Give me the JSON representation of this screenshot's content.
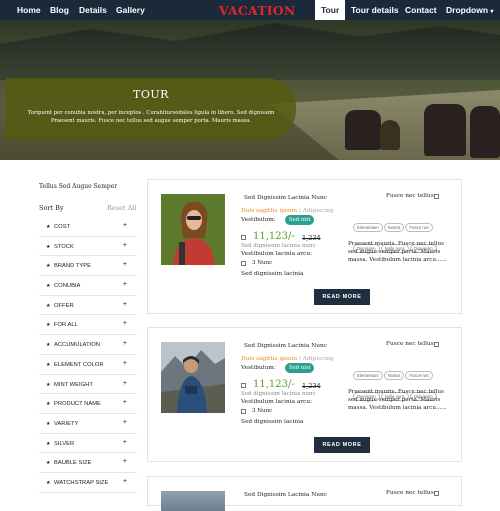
{
  "nav": {
    "items": [
      "Home",
      "Blog",
      "Details",
      "Gallery"
    ],
    "brand": "VACATION",
    "right": [
      "Tour",
      "Tour details",
      "Contact",
      "Dropdown"
    ]
  },
  "hero": {
    "title": "TOUR",
    "desc": "Torquent per conubia nostra, per inceptos . Curabitursodales ligula in libero. Sed dignissim Praesent mauris. Fusce nec tellus sed augue semper porta. Mauris massa."
  },
  "sidebar": {
    "title": "Tellus Sed Augue Semper",
    "sort_label": "Sort By",
    "reset_label": "Reset All",
    "filters": [
      "COST",
      "STOCK",
      "BRAND TYPE",
      "CONUBIA",
      "OFFER",
      "FOR ALL",
      "ACCUMULATION",
      "ELEMENT COLOR",
      "MINT WEIGHT",
      "PRODUCT NAME",
      "VARIETY",
      "SILVER",
      "BAUBLE SIZE",
      "WATCHSTRAP SIZE"
    ]
  },
  "cards": [
    {
      "name": "Sed Dignissim Lacinia Nunc",
      "sub": "Duis sagittis ipsum",
      "sub2": "Adipiscing",
      "vest": "Vestibulum:",
      "badge": "Sed nisi",
      "price": "11,123/-",
      "old": "1,234",
      "line1": "Sed dignissim lacinia nunc",
      "line2": "Vestibulum lacinia arcu:",
      "line3": "3 Nunc",
      "line4": "Sed dignissim lacinia",
      "filter_title": "Fusce nec tellus",
      "tags": [
        "Elementum",
        "Nostra",
        "Fusce nec",
        "Dignissim",
        "Nulla nunc",
        "Dignissim"
      ],
      "desc": "Praesent mauris. Fusce nec tellus sed augue semper porta. Mauris massa. Vestibulum lacinia arcu......",
      "more": "READ MORE"
    },
    {
      "name": "Sed Dignissim Lacinia Nunc",
      "sub": "Duis sagittis ipsum",
      "sub2": "Adipiscing",
      "vest": "Vestibulum:",
      "badge": "Sed nisi",
      "price": "11,123/-",
      "old": "1,234",
      "line1": "Sed dignissim lacinia nunc",
      "line2": "Vestibulum lacinia arcu:",
      "line3": "3 Nunc",
      "line4": "Sed dignissim lacinia",
      "filter_title": "Fusce nec tellus",
      "tags": [
        "Elementum",
        "Nostra",
        "Fusce nec",
        "Dignissim",
        "Nulla nunc",
        "Dignissim"
      ],
      "desc": "Praesent mauris. Fusce nec tellus sed augue semper porta. Mauris massa. Vestibulum lacinia arcu......",
      "more": "READ MORE"
    },
    {
      "name": "Sed Dignissim Lacinia Nunc",
      "filter_title": "Fusce nec tellus"
    }
  ]
}
